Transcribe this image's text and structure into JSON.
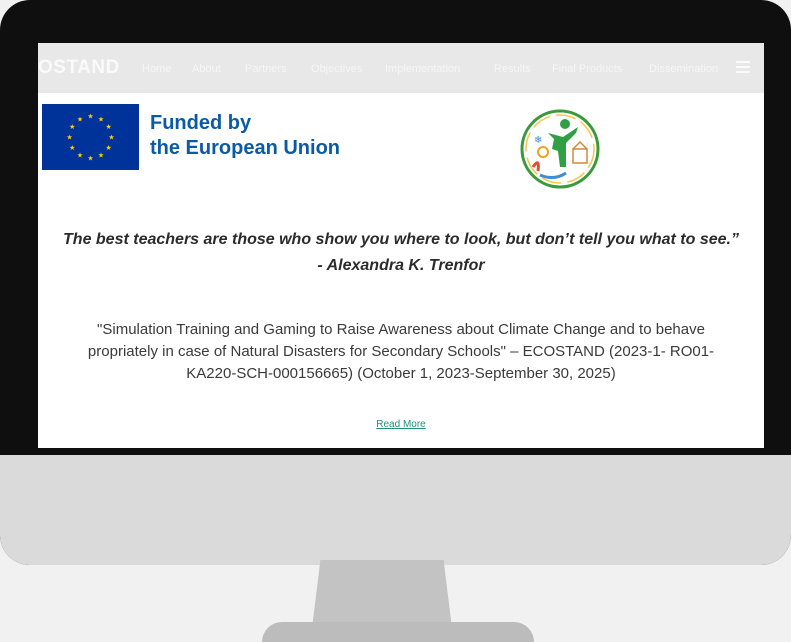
{
  "navbar": {
    "brand": "OSTAND",
    "items": [
      {
        "label": "Home"
      },
      {
        "label": "About"
      },
      {
        "label": "Partners"
      },
      {
        "label": "Objectives"
      },
      {
        "label": "Implementation"
      },
      {
        "label": "Results"
      },
      {
        "label": "Final Products"
      },
      {
        "label": "Dissemination"
      }
    ]
  },
  "funding": {
    "line1": "Funded by",
    "line2": "the European Union"
  },
  "quote": {
    "text": "The best teachers are those who show you where to look, but don’t tell you what to see.”",
    "author": "- Alexandra K. Trenfor"
  },
  "description": {
    "line1": "\"Simulation Training and Gaming to Raise Awareness about Climate Change and to behave",
    "line2": "propriately in case of Natural Disasters for Secondary Schools\" – ECOSTAND (2023-1- RO01-",
    "line3": "KA220-SCH-000156665) (October 1, 2023-September 30, 2025)"
  },
  "read_more": "Read More",
  "colors": {
    "eu_blue": "#003399",
    "eu_star": "#ffcc00",
    "funded_text": "#0b5aa6",
    "link": "#1f8f7a",
    "logo_green": "#3a9a3a"
  }
}
